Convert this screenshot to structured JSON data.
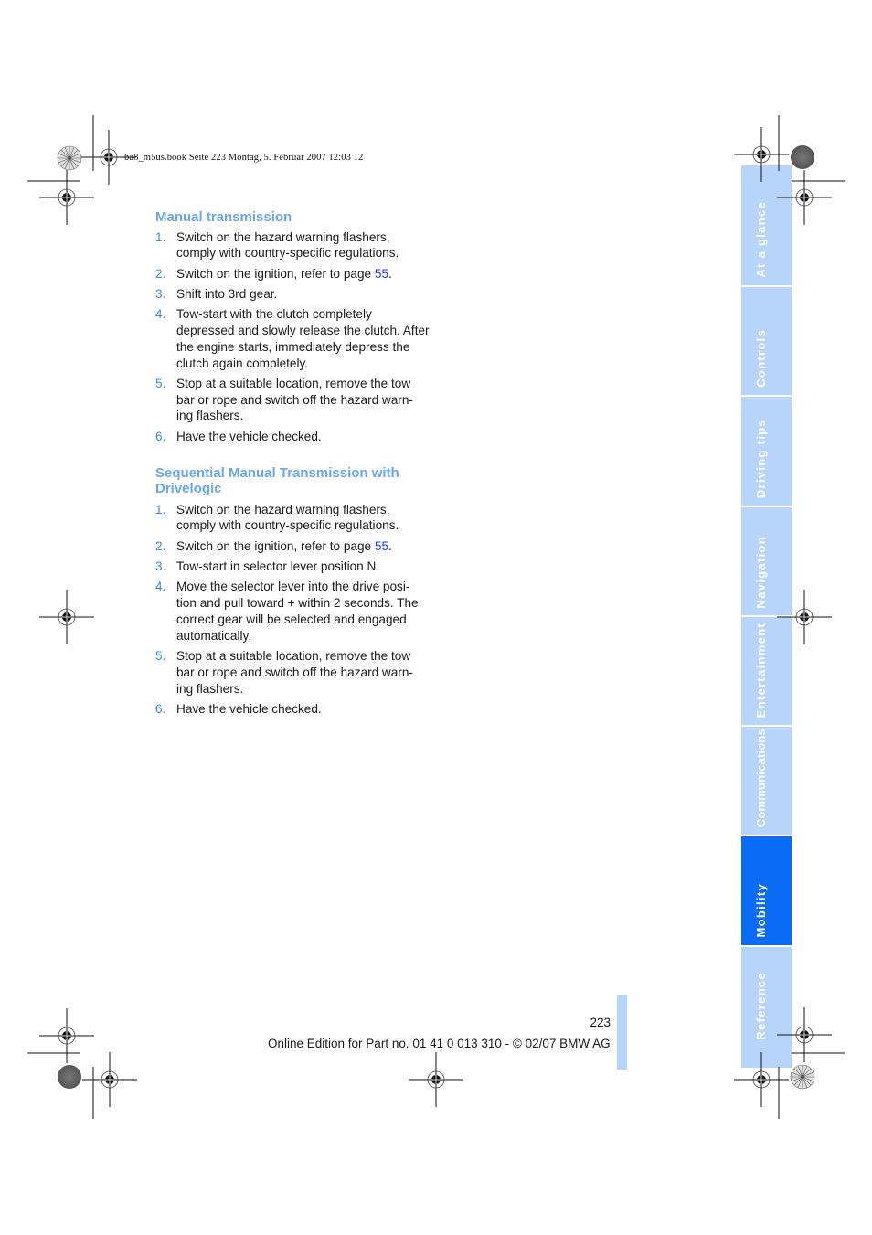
{
  "print_header": "ba8_m5us.book  Seite 223  Montag, 5. Februar 2007  12:03 12",
  "sections": [
    {
      "title": "Manual transmission",
      "steps": [
        {
          "num": "1.",
          "text": "Switch on the hazard warning flashers, comply with country-specific regulations."
        },
        {
          "num": "2.",
          "text_before": "Switch on the ignition, refer to page ",
          "link": "55",
          "text_after": "."
        },
        {
          "num": "3.",
          "text": "Shift into 3rd gear."
        },
        {
          "num": "4.",
          "text": "Tow-start with the clutch completely depressed and slowly release the clutch. After the engine starts, immediately depress the clutch again completely."
        },
        {
          "num": "5.",
          "text": "Stop at a suitable location, remove the tow bar or rope and switch off the hazard warn-ing flashers."
        },
        {
          "num": "6.",
          "text": "Have the vehicle checked."
        }
      ]
    },
    {
      "title": "Sequential Manual Transmission with Drivelogic",
      "steps": [
        {
          "num": "1.",
          "text": "Switch on the hazard warning flashers, comply with country-specific regulations."
        },
        {
          "num": "2.",
          "text_before": "Switch on the ignition, refer to page ",
          "link": "55",
          "text_after": "."
        },
        {
          "num": "3.",
          "text": "Tow-start in selector lever position N."
        },
        {
          "num": "4.",
          "text": "Move the selector lever into the drive posi-tion and pull toward + within 2 seconds. The correct gear will be selected and engaged automatically."
        },
        {
          "num": "5.",
          "text": "Stop at a suitable location, remove the tow bar or rope and switch off the hazard warn-ing flashers."
        },
        {
          "num": "6.",
          "text": "Have the vehicle checked."
        }
      ]
    }
  ],
  "sidebar": {
    "tabs": [
      {
        "label": "At a glance",
        "active": false
      },
      {
        "label": "Controls",
        "active": false
      },
      {
        "label": "Driving tips",
        "active": false
      },
      {
        "label": "Navigation",
        "active": false
      },
      {
        "label": "Entertainment",
        "active": false
      },
      {
        "label": "Communications",
        "active": false
      },
      {
        "label": "Mobility",
        "active": true
      },
      {
        "label": "Reference",
        "active": false
      }
    ]
  },
  "footer": {
    "page_number": "223",
    "edition": "Online Edition for Part no. 01 41 0 013 310 - © 02/07 BMW AG"
  },
  "colors": {
    "heading": "#6aa8f0",
    "list_number": "#3a8ae8",
    "page_link": "#1a3ee8",
    "tab_inactive": "#b7d5fb",
    "tab_active": "#0a6cf5"
  }
}
